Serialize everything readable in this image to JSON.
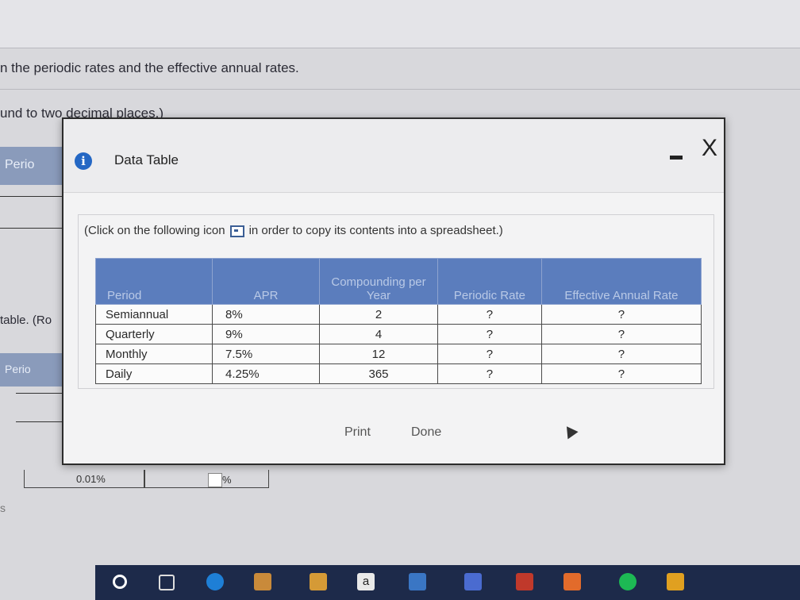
{
  "background": {
    "line1": "n the periodic rates and the effective annual rates.",
    "line2": "und to two decimal places.)",
    "left_header_1": "Perio",
    "left_text": "table. (Ro",
    "left_header_2": "Perio",
    "small_s": "s",
    "bottom_value": "0.01%",
    "bottom_percent": "%"
  },
  "modal": {
    "title": "Data Table",
    "minimize_label": "—",
    "close_label": "X",
    "instructions_before": "(Click on the following icon",
    "instructions_after": "in order to copy its contents into a spreadsheet.)",
    "print_label": "Print",
    "done_label": "Done"
  },
  "table": {
    "headers": [
      "Period",
      "APR",
      "Compounding per Year",
      "Periodic Rate",
      "Effective Annual Rate"
    ],
    "rows": [
      {
        "period": "Semiannual",
        "apr": "8%",
        "compounding": "2",
        "periodic": "?",
        "effective": "?"
      },
      {
        "period": "Quarterly",
        "apr": "9%",
        "compounding": "4",
        "periodic": "?",
        "effective": "?"
      },
      {
        "period": "Monthly",
        "apr": "7.5%",
        "compounding": "12",
        "periodic": "?",
        "effective": "?"
      },
      {
        "period": "Daily",
        "apr": "4.25%",
        "compounding": "365",
        "periodic": "?",
        "effective": "?"
      }
    ]
  },
  "taskbar": {
    "icons": [
      "search-circle-icon",
      "task-view-icon",
      "edge-browser-icon",
      "app-icon",
      "store-icon",
      "amazon-icon",
      "mail-icon",
      "dollar-icon",
      "red-app-icon",
      "office-icon",
      "spotify-icon",
      "yellow-app-icon"
    ],
    "amazon_label": "a"
  }
}
